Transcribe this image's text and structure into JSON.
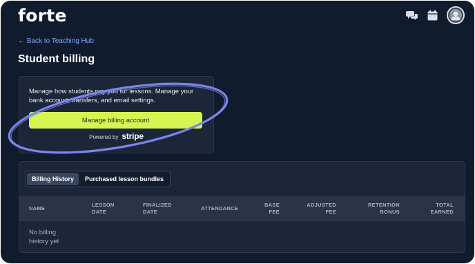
{
  "header": {
    "logo": "forte",
    "icons": [
      "chat-bubbles-icon",
      "calendar-icon",
      "avatar"
    ]
  },
  "nav": {
    "back_link": "← Back to Teaching Hub"
  },
  "page": {
    "title": "Student billing"
  },
  "billing": {
    "description": "Manage how students pay you for lessons. Manage your bank account, transfers, and email settings.",
    "button_label": "Manage billing account",
    "powered_by": "Powered by",
    "provider": "stripe"
  },
  "history": {
    "tabs": [
      {
        "label": "Billing History",
        "active": true
      },
      {
        "label": "Purchased lesson bundles",
        "active": false
      }
    ],
    "columns": [
      {
        "line1": "NAME",
        "line2": ""
      },
      {
        "line1": "LESSON",
        "line2": "DATE"
      },
      {
        "line1": "FINALIZED",
        "line2": "DATE"
      },
      {
        "line1": "ATTENDANCE",
        "line2": ""
      },
      {
        "line1": "BASE",
        "line2": "FEE"
      },
      {
        "line1": "ADJUSTED",
        "line2": "FEE"
      },
      {
        "line1": "RETENTION",
        "line2": "BONUS"
      },
      {
        "line1": "TOTAL",
        "line2": "EARNED"
      }
    ],
    "empty_message": "No billing history yet"
  },
  "colors": {
    "background": "#111b2e",
    "card": "#1c2638",
    "accent_button": "#d6f550",
    "link": "#7aa8ff",
    "annotation": "#7b86e8"
  }
}
